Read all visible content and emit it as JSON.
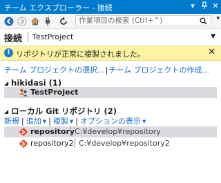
{
  "titlebar": {
    "title": "チーム エクスプローラー - 接続",
    "buttons": [
      "▾",
      "ᛒ",
      "✕"
    ]
  },
  "toolbar": {
    "search_placeholder": "作業項目の検索 (Ctrl+^)",
    "icons": [
      "back-icon",
      "forward-icon",
      "home-icon",
      "refresh-icon"
    ]
  },
  "header": {
    "title": "接続",
    "subtitle": "TestProject",
    "dropdown": "▼"
  },
  "infobar": {
    "icon": "i",
    "message": "リポジトリが正常に複製されました。",
    "close": "✕"
  },
  "links": {
    "select_project": "チーム プロジェクトの選択...",
    "separator": "|",
    "create_project": "チーム プロジェクトの作成..."
  },
  "server": {
    "title": "hikidasi (1)",
    "projects": [
      {
        "name": "TestProject"
      }
    ]
  },
  "local_git": {
    "title": "ローカル Git リポジトリ (2)",
    "actions": [
      {
        "label": "新規"
      },
      {
        "label": "追加"
      },
      {
        "label": "複製"
      },
      {
        "label": "オプションの表示"
      }
    ],
    "repositories": [
      {
        "name": "repository",
        "path": "C:¥develop¥repository",
        "selected": true
      },
      {
        "name": "repository2",
        "path": "C:¥develop¥repository2",
        "selected": false
      }
    ]
  },
  "colors": {
    "accent": "#007acc",
    "link": "#1e6fc8",
    "info_bg": "#fcf4a4",
    "git": "#e94e31"
  }
}
